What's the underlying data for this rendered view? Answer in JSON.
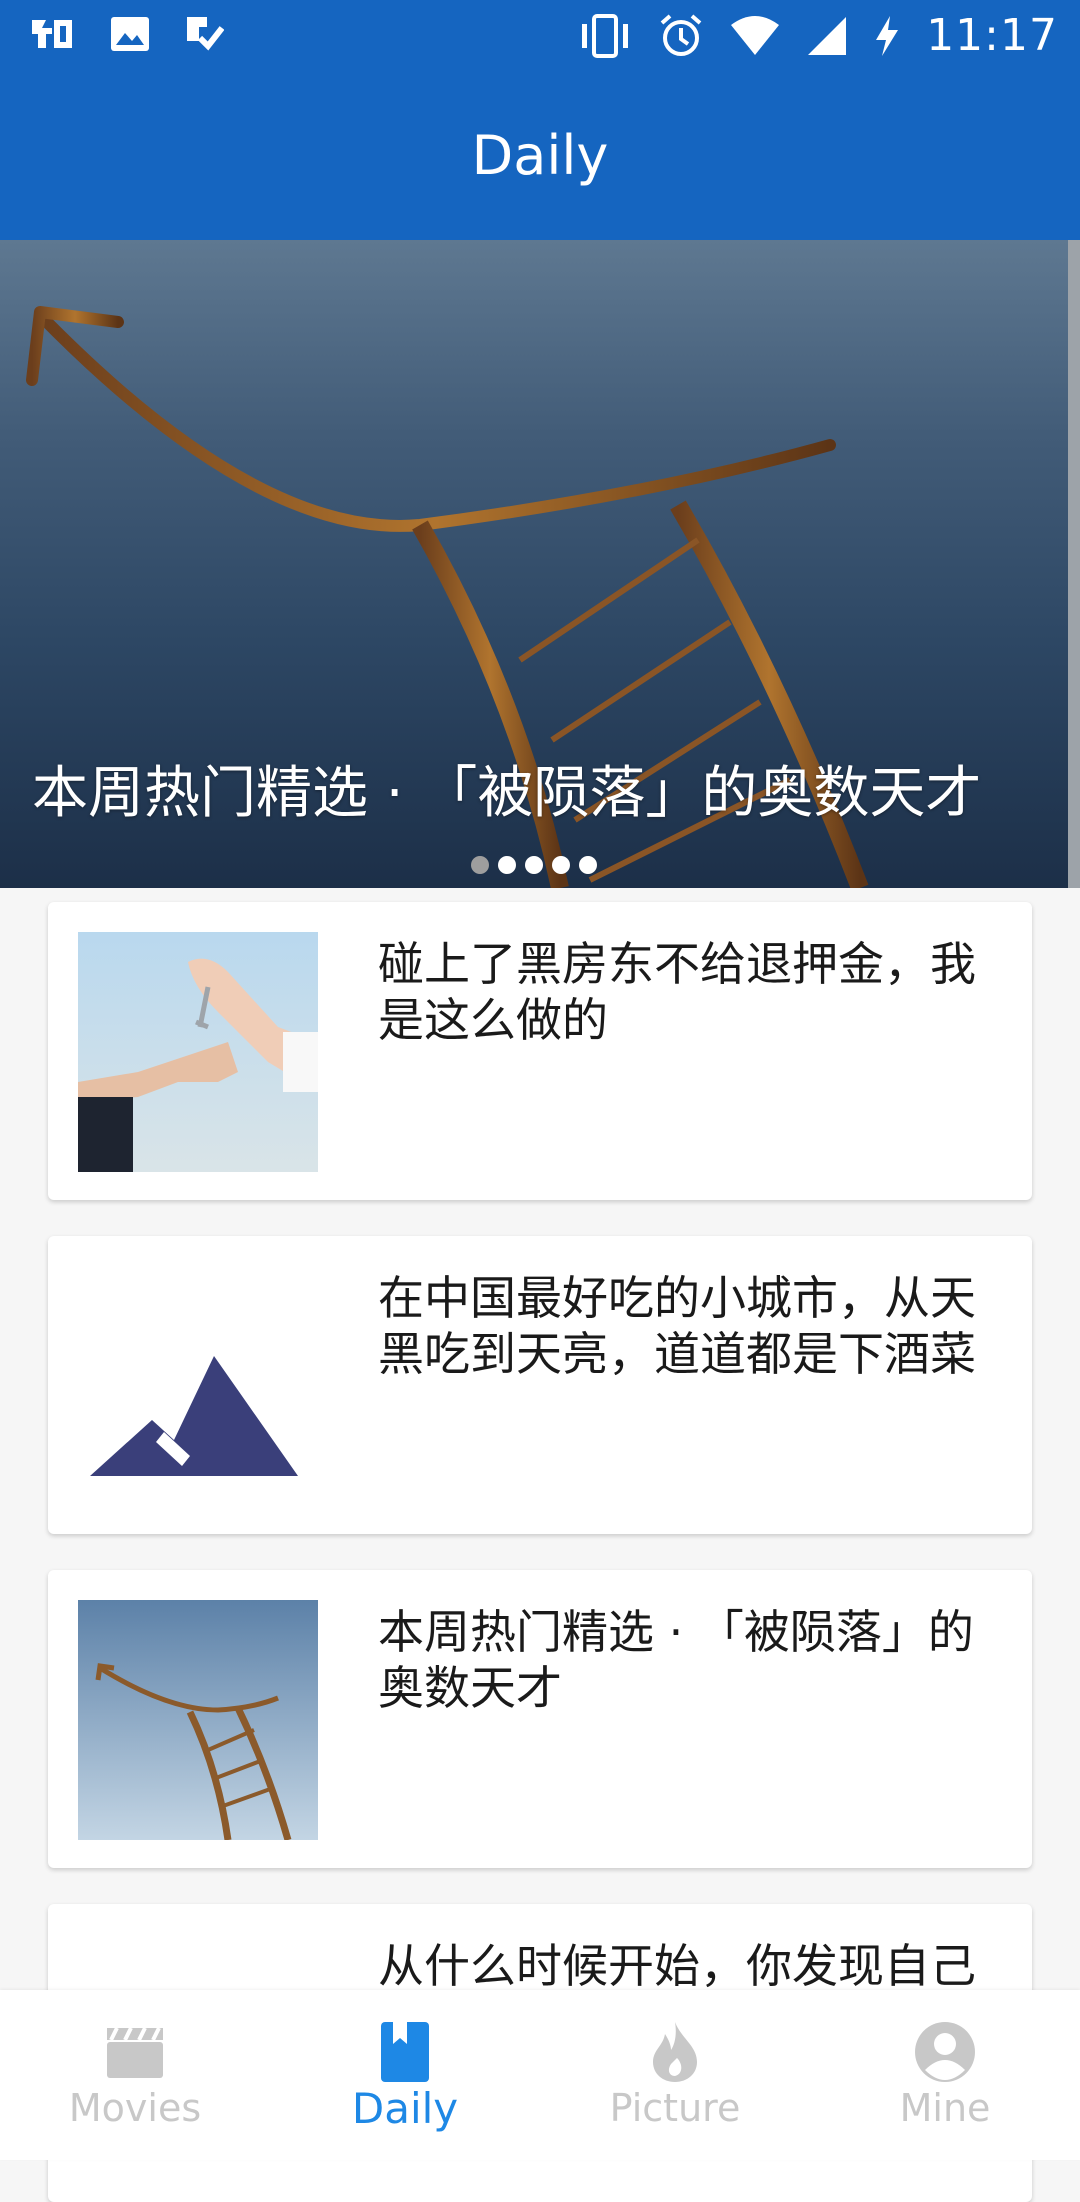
{
  "status_bar": {
    "time": "11:17",
    "left_icons": [
      "weibo-icon",
      "image-icon",
      "task-check-icon"
    ],
    "right_icons": [
      "vibrate-icon",
      "alarm-icon",
      "wifi-icon",
      "signal-icon",
      "charging-icon"
    ]
  },
  "app_bar": {
    "title": "Daily"
  },
  "banner": {
    "caption": "本周热门精选 · 「被陨落」的奥数天才",
    "indicator": {
      "count": 5,
      "active_index": 0
    }
  },
  "articles": [
    {
      "title": "碰上了黑房东不给退押金，我是这么做的",
      "thumbnail": "handing-keys-photo"
    },
    {
      "title": "在中国最好吃的小城市，从天黑吃到天亮，道道都是下酒菜",
      "thumbnail": "image-placeholder-icon"
    },
    {
      "title": "本周热门精选 · 「被陨落」的奥数天才",
      "thumbnail": "curved-ladder-photo"
    },
    {
      "title": "从什么时候开始，你发现自己",
      "thumbnail": ""
    }
  ],
  "bottom_nav": {
    "active": "Daily",
    "items": [
      {
        "label": "Movies",
        "icon": "clapperboard-icon"
      },
      {
        "label": "Daily",
        "icon": "bookmark-book-icon"
      },
      {
        "label": "Picture",
        "icon": "flame-icon"
      },
      {
        "label": "Mine",
        "icon": "user-avatar-icon"
      }
    ]
  },
  "colors": {
    "primary": "#1565c0",
    "nav_active": "#1e88e5",
    "nav_inactive": "#c8c8c8",
    "placeholder_icon": "#3a3f7a"
  }
}
